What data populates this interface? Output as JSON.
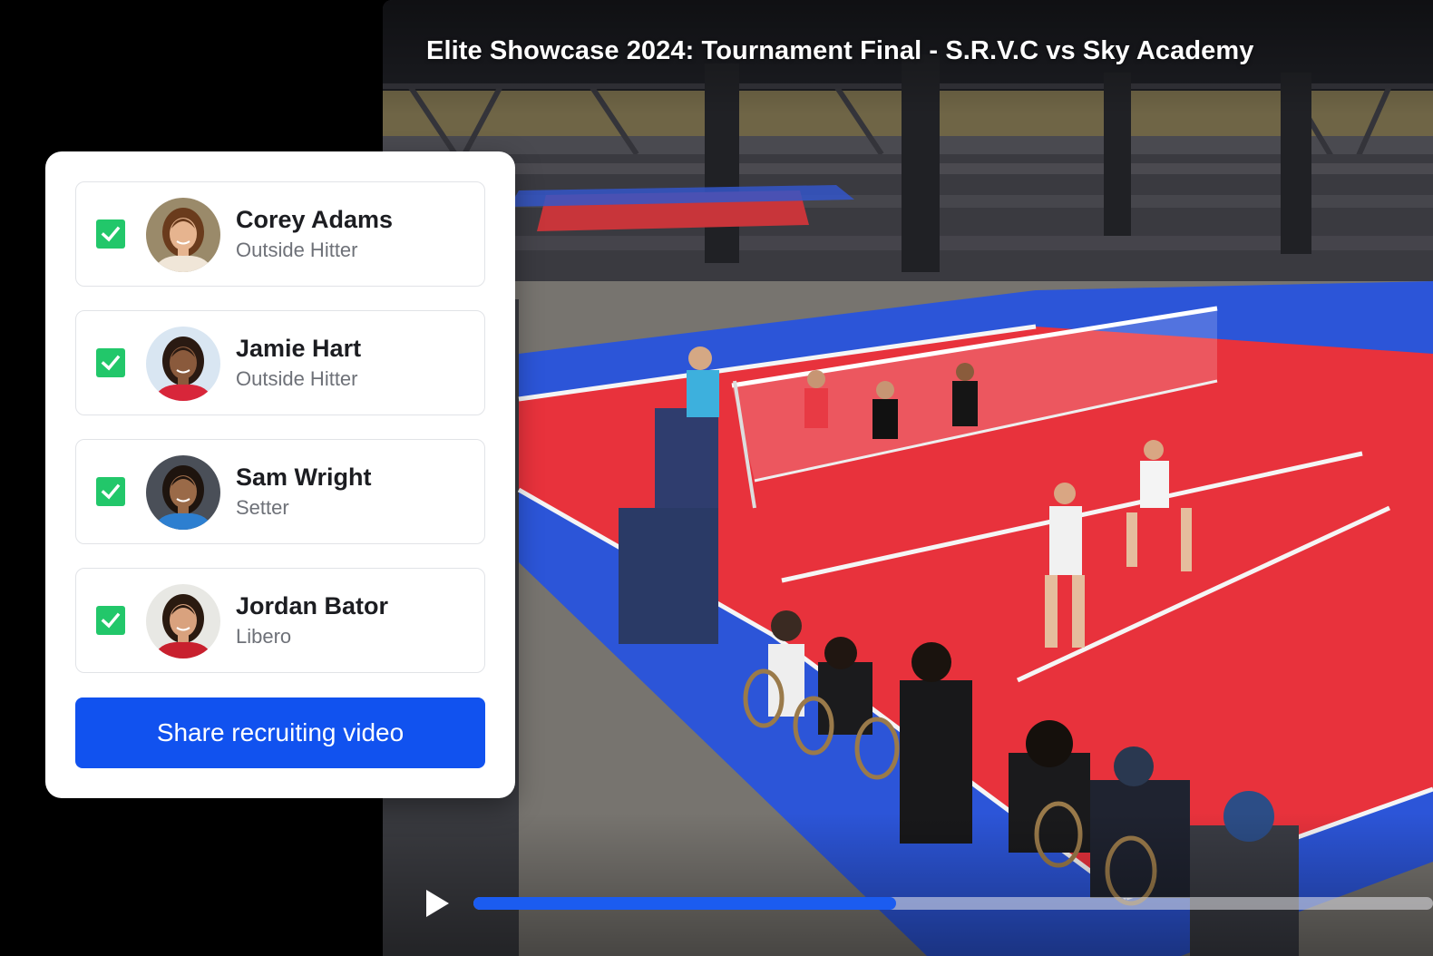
{
  "video": {
    "title": "Elite Showcase 2024: Tournament Final - S.R.V.C vs Sky Academy",
    "play_icon": "play-icon",
    "progress": 0.44,
    "colors": {
      "progress_fill": "#1b5cf0",
      "court_red": "#e8323c",
      "court_blue": "#2c55d8"
    }
  },
  "card": {
    "athletes": [
      {
        "name": "Corey Adams",
        "position": "Outside Hitter",
        "checked": true,
        "jersey": "#f0e6d8",
        "hair": "#6a3b1c",
        "skin": "#e6b48f",
        "bg": "#9a8a6a"
      },
      {
        "name": "Jamie Hart",
        "position": "Outside Hitter",
        "checked": true,
        "jersey": "#d8263a",
        "hair": "#2a1a12",
        "skin": "#8a5a3c",
        "bg": "#d9e6f2"
      },
      {
        "name": "Sam Wright",
        "position": "Setter",
        "checked": true,
        "jersey": "#2d7fd0",
        "hair": "#1e140e",
        "skin": "#9a6a48",
        "bg": "#4a4f58"
      },
      {
        "name": "Jordan Bator",
        "position": "Libero",
        "checked": true,
        "jersey": "#c8202e",
        "hair": "#2a1a10",
        "skin": "#d9a27e",
        "bg": "#e8e8e4"
      }
    ],
    "share_label": "Share recruiting video",
    "colors": {
      "check": "#22c76a",
      "button": "#1152ef"
    }
  }
}
